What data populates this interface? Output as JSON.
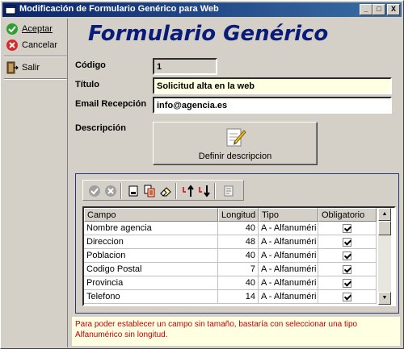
{
  "window": {
    "title": "Modificación de Formulario Genérico para Web",
    "controls": {
      "minimize": "_",
      "maximize": "□",
      "close": "X"
    }
  },
  "sidebar": {
    "accept_label": "Aceptar",
    "cancel_label": "Cancelar",
    "exit_label": "Salir"
  },
  "main": {
    "heading": "Formulario Genérico",
    "codigo_label": "Código",
    "codigo_value": "1",
    "titulo_label": "Título",
    "titulo_value": "Solicitud alta en la web",
    "email_label": "Email Recepción",
    "email_value": "info@agencia.es",
    "descripcion_label": "Descripción",
    "definir_label": "Definir descripcion"
  },
  "table": {
    "columns": [
      "Campo",
      "Longitud",
      "Tipo",
      "Obligatorio"
    ],
    "rows": [
      {
        "campo": "Nombre agencia",
        "longitud": "40",
        "tipo": "A - Alfanuméri",
        "obligatorio": true
      },
      {
        "campo": "Direccion",
        "longitud": "48",
        "tipo": "A - Alfanuméri",
        "obligatorio": true
      },
      {
        "campo": "Poblacion",
        "longitud": "40",
        "tipo": "A - Alfanuméri",
        "obligatorio": true
      },
      {
        "campo": "Codigo Postal",
        "longitud": "7",
        "tipo": "A - Alfanuméri",
        "obligatorio": true
      },
      {
        "campo": "Provincia",
        "longitud": "40",
        "tipo": "A - Alfanuméri",
        "obligatorio": true
      },
      {
        "campo": "Telefono",
        "longitud": "14",
        "tipo": "A - Alfanuméri",
        "obligatorio": true
      }
    ]
  },
  "hint": "Para poder establecer un campo sin tamaño, bastaría con seleccionar una tipo Alfanumérico sin longitud.",
  "colors": {
    "title_start": "#0a246a",
    "heading": "#0a1c7a",
    "hint_text": "#c00000",
    "hint_bg": "#ffffe1"
  },
  "icons": [
    "app-icon",
    "check-icon",
    "cancel-icon",
    "exit-icon",
    "edit-icon",
    "confirm-icon",
    "discard-icon",
    "new-icon",
    "copy-icon",
    "eraser-icon",
    "move-up-icon",
    "move-down-icon",
    "properties-icon"
  ]
}
